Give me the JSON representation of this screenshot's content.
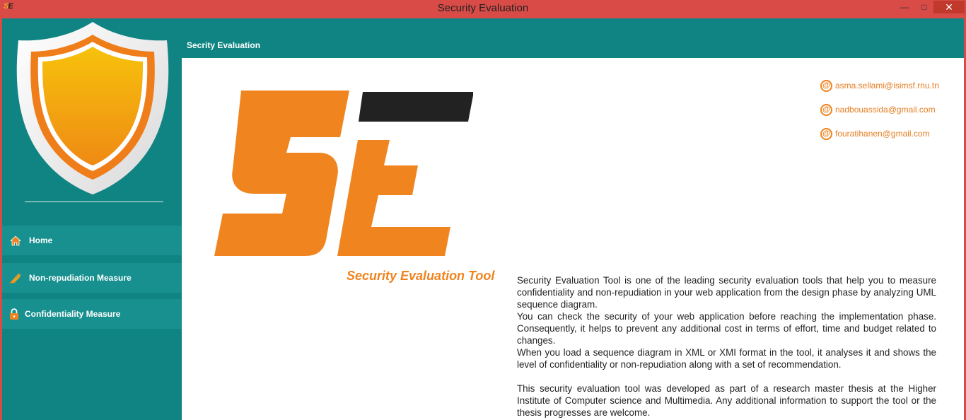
{
  "window": {
    "title": "Security Evaluation",
    "icon_text_left": "S",
    "icon_text_right": "E",
    "minimize_symbol": "—",
    "maximize_symbol": "□",
    "close_symbol": "✕"
  },
  "topbar": {
    "title": "Secrity Evaluation"
  },
  "sidebar": {
    "items": [
      {
        "label": "Home",
        "icon": "home-icon"
      },
      {
        "label": "Non-repudiation Measure",
        "icon": "signature-icon"
      },
      {
        "label": "Confidentiality Measure",
        "icon": "lock-icon"
      }
    ]
  },
  "logo": {
    "caption": "Security Evaluation Tool"
  },
  "emails": [
    "asma.sellami@isimsf.rnu.tn",
    "nadbouassida@gmail.com",
    "fouratihanen@gmail.com"
  ],
  "description": {
    "p1": "Security Evaluation Tool is one of the leading security evaluation tools that help you to measure confidentiality and non-repudiation in your web application from the design phase by analyzing UML sequence diagram.",
    "p2": "You can check the security of your web application before reaching the implementation phase. Consequently, it helps to prevent any additional cost in terms of effort, time and budget related to changes.",
    "p3": "When you load a sequence diagram in XML or XMI format in the tool, it analyses it and shows the level of confidentiality or non-repudiation along with a set of recommendation.",
    "p4": "This security evaluation tool was developed as part of a research master thesis at the Higher Institute of Computer science and Multimedia. Any additional information to support the tool or the thesis progresses are welcome."
  },
  "colors": {
    "titlebar": "#d94b47",
    "teal": "#0f8483",
    "nav_item": "#17908f",
    "accent_orange": "#f0841f",
    "logo_dark": "#222222"
  }
}
